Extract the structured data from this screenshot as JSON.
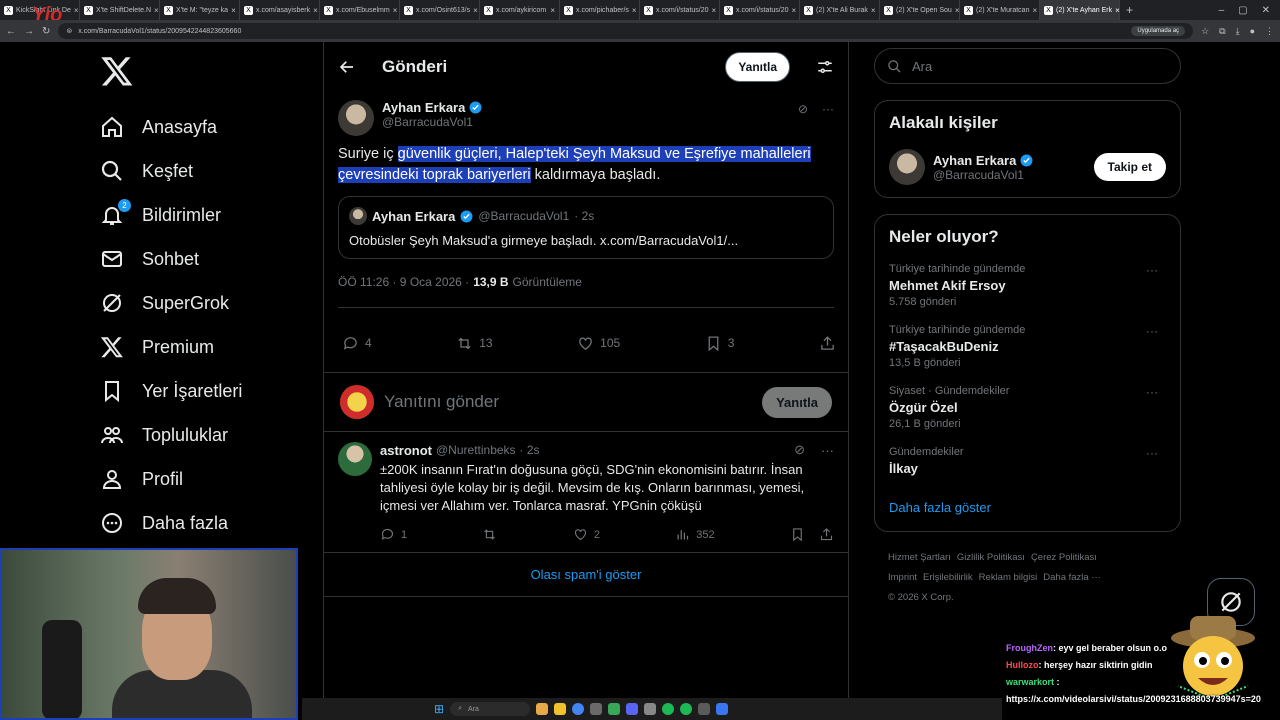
{
  "browser": {
    "tabs": [
      {
        "label": "KickSight Link De"
      },
      {
        "label": "X'te ShiftDelete.N"
      },
      {
        "label": "X'te M: \"teyze ka"
      },
      {
        "label": "x.com/asayisberk"
      },
      {
        "label": "x.com/Ebuselmm"
      },
      {
        "label": "x.com/Osint613/s"
      },
      {
        "label": "x.com/aykiricom"
      },
      {
        "label": "x.com/pichaber/s"
      },
      {
        "label": "x.com/i/status/20"
      },
      {
        "label": "x.com/i/status/20"
      },
      {
        "label": "(2) X'te Ali Burak"
      },
      {
        "label": "(2) X'te Open Sou"
      },
      {
        "label": "(2) X'te Muratcan"
      },
      {
        "label": "(2) X'te Ayhan Erk"
      }
    ],
    "url": "x.com/BarracudaVol1/status/2009542244823605660",
    "app_chip": "Uygulamada aç"
  },
  "nav": {
    "items": [
      {
        "label": "Anasayfa",
        "icon": "home-icon"
      },
      {
        "label": "Keşfet",
        "icon": "search-icon"
      },
      {
        "label": "Bildirimler",
        "icon": "bell-icon",
        "badge": "2"
      },
      {
        "label": "Sohbet",
        "icon": "mail-icon"
      },
      {
        "label": "SuperGrok",
        "icon": "grok-icon"
      },
      {
        "label": "Premium",
        "icon": "x-icon"
      },
      {
        "label": "Yer İşaretleri",
        "icon": "bookmark-icon"
      },
      {
        "label": "Topluluklar",
        "icon": "people-icon"
      },
      {
        "label": "Profil",
        "icon": "person-icon"
      },
      {
        "label": "Daha fazla",
        "icon": "more-icon"
      }
    ]
  },
  "header": {
    "title": "Gönderi",
    "reply_button": "Yanıtla"
  },
  "post": {
    "author_name": "Ayhan Erkara",
    "author_handle": "@BarracudaVol1",
    "text_before": "Suriye iç ",
    "text_highlight": "güvenlik güçleri, Halep'teki Şeyh Maksud ve Eşrefiye mahalleleri çevresindeki toprak bariyerleri",
    "text_after": " kaldırmaya başladı.",
    "quote": {
      "author_name": "Ayhan Erkara",
      "author_handle": "@BarracudaVol1",
      "time": "· 2s",
      "text": "Otobüsler Şeyh Maksud'a girmeye başladı. x.com/BarracudaVol1/..."
    },
    "timestamp": "ÖÖ 11:26 · 9 Oca 2026 ·",
    "views": "13,9 B",
    "views_label": "Görüntüleme",
    "stats": {
      "replies": "4",
      "reposts": "13",
      "likes": "105",
      "bookmarks": "3"
    }
  },
  "compose": {
    "placeholder": "Yanıtını gönder",
    "button": "Yanıtla"
  },
  "reply": {
    "author_name": "astronot",
    "author_handle": "@Nurettinbeks",
    "time": "· 2s",
    "text": "±200K insanın Fırat'ın doğusuna göçü, SDG'nin ekonomisini batırır. İnsan tahliyesi öyle kolay bir iş değil. Mevsim de kış. Onların barınması, yemesi, içmesi ver Allahım ver. Tonlarca masraf. YPGnin çöküşü",
    "stats": {
      "replies": "1",
      "likes": "2",
      "views": "352"
    }
  },
  "spam_link": "Olası spam'i göster",
  "search": {
    "placeholder": "Ara"
  },
  "related": {
    "title": "Alakalı kişiler",
    "name": "Ayhan Erkara",
    "handle": "@BarracudaVol1",
    "follow": "Takip et"
  },
  "trends": {
    "title": "Neler oluyor?",
    "items": [
      {
        "category": "Türkiye tarihinde gündemde",
        "name": "Mehmet Akif Ersoy",
        "count": "5.758 gönderi"
      },
      {
        "category": "Türkiye tarihinde gündemde",
        "name": "#TaşacakBuDeniz",
        "count": "13,5 B gönderi"
      },
      {
        "category": "Siyaset · Gündemdekiler",
        "name": "Özgür Özel",
        "count": "26,1 B gönderi"
      },
      {
        "category": "Gündemdekiler",
        "name": "İlkay",
        "count": ""
      }
    ],
    "more": "Daha fazla göster"
  },
  "footer": {
    "links": [
      "Hizmet Şartları",
      "Gizlilik Politikası",
      "Çerez Politikası",
      "Imprint",
      "Erişilebilirlik",
      "Reklam bilgisi",
      "Daha fazla ···"
    ],
    "copyright": "© 2026 X Corp."
  },
  "chat": {
    "lines": [
      {
        "user": "FroughZen",
        "text": ": eyv gel beraber olsun o.o"
      },
      {
        "user": "Hullozo",
        "text": ": herşey hazır siktirin gidin"
      },
      {
        "user": "warwarkort",
        "text": " :"
      }
    ],
    "link": "https://x.com/videolarsivi/status/2009231688803739947s=20"
  },
  "taskbar": {
    "search": "Ara"
  },
  "colors": {
    "accent": "#1d9bf0",
    "highlight": "#1d3fb8",
    "background": "#000000",
    "border": "#2f3336"
  }
}
